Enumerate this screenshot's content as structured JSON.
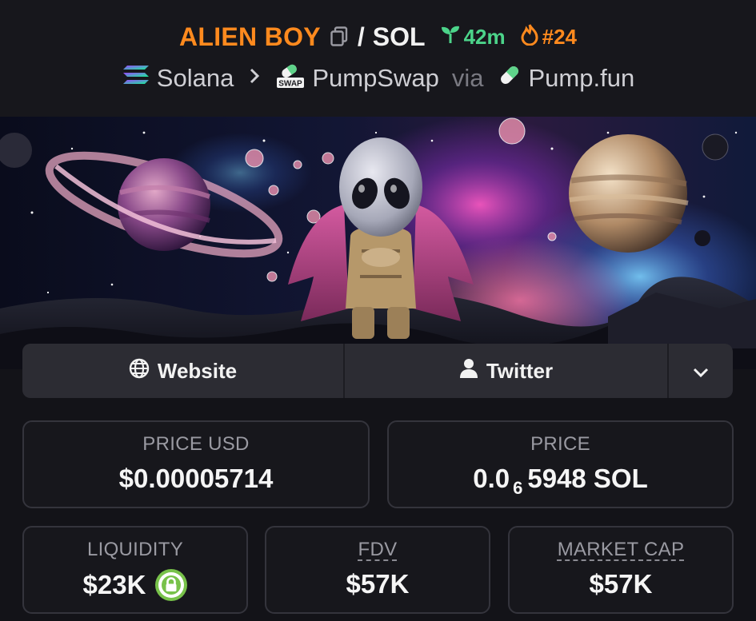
{
  "header": {
    "token_symbol": "ALIEN BOY",
    "slash": "/",
    "quote_symbol": "SOL",
    "age": "42m",
    "rank": "#24",
    "chain": "Solana",
    "dex": "PumpSwap",
    "dex_badge": "SWAP",
    "via": "via",
    "launchpad": "Pump.fun"
  },
  "links": {
    "website": "Website",
    "twitter": "Twitter"
  },
  "stats": {
    "price_usd_label": "PRICE USD",
    "price_usd_value": "$0.00005714",
    "price_label": "PRICE",
    "price_prefix": "0.0",
    "price_zeros": "6",
    "price_digits": "5948 SOL",
    "liquidity_label": "LIQUIDITY",
    "liquidity_value": "$23K",
    "fdv_label": "FDV",
    "fdv_value": "$57K",
    "mcap_label": "MARKET CAP",
    "mcap_value": "$57K"
  },
  "colors": {
    "background": "#131318",
    "token_accent": "#ff8a1e",
    "age_green": "#4cd48a",
    "card_border": "#34343c",
    "lock_green": "#78c24a"
  },
  "icons": {
    "copy": "copy-icon",
    "age": "seedling-icon",
    "rank": "flame-icon",
    "chain": "solana-icon",
    "dex": "pumpswap-icon",
    "launchpad": "pill-icon",
    "website": "globe-icon",
    "twitter": "user-icon",
    "more": "chevron-down-icon",
    "liquidity": "lock-icon"
  }
}
